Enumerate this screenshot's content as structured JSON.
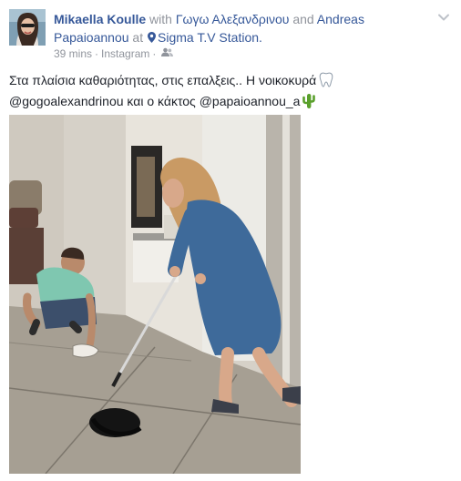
{
  "post": {
    "author": "Mikaella Koulle",
    "with_word": "with",
    "tagged_1": "Γωγω Αλεξανδρινου",
    "and_word": "and",
    "tagged_2": "Andreas Papaioannou",
    "at_word": "at",
    "place": "Sigma T.V Station.",
    "time": "39 mins",
    "separator": "·",
    "source": "Instagram",
    "separator_2": "·",
    "text_line_1": "Στα πλαίσια καθαριότητας, στις επαλξεις.. Η νοικοκυρά",
    "text_line_2": "@gogoalexandrinou και ο κάκτος @papaioannou_a",
    "audience_icon": "friends-icon",
    "options_icon": "chevron-down-icon",
    "place_icon": "location-pin-icon",
    "emoji_1": "tooth-emoji",
    "emoji_2": "cactus-emoji"
  },
  "colors": {
    "link": "#365899",
    "text": "#1d2129",
    "muted": "#90949c",
    "cactus": "#5aa02c"
  }
}
